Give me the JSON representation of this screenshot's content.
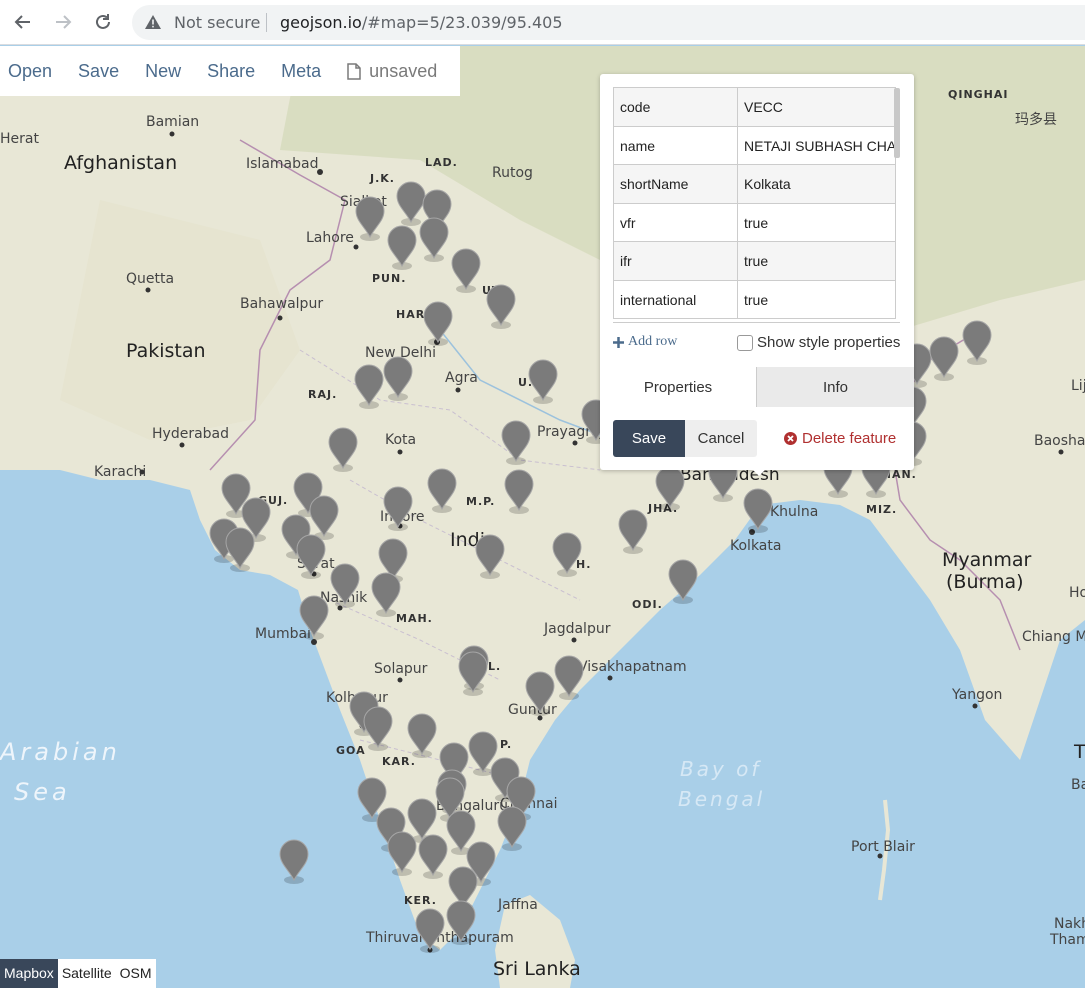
{
  "browser": {
    "security_label": "Not secure",
    "url_host": "geojson.io",
    "url_path": "/#map=5/23.039/95.405"
  },
  "toolbar": {
    "open": "Open",
    "save": "Save",
    "new": "New",
    "share": "Share",
    "meta": "Meta",
    "file_status": "unsaved"
  },
  "popup": {
    "properties": [
      {
        "key": "code",
        "value": "VECC"
      },
      {
        "key": "name",
        "value": "NETAJI SUBHASH CHANDRA BOSE INTL"
      },
      {
        "key": "shortName",
        "value": "Kolkata"
      },
      {
        "key": "vfr",
        "value": "true"
      },
      {
        "key": "ifr",
        "value": "true"
      },
      {
        "key": "international",
        "value": "true"
      }
    ],
    "add_row": "Add row",
    "show_style": "Show style properties",
    "tab_properties": "Properties",
    "tab_info": "Info",
    "save": "Save",
    "cancel": "Cancel",
    "delete": "Delete feature"
  },
  "map_labels": {
    "countries": [
      "Afghanistan",
      "Pakistan",
      "India",
      "Myanmar",
      "(Burma)",
      "Sri Lanka"
    ],
    "states": [
      "J.K.",
      "LAD.",
      "PUN.",
      "HAR.",
      "RAJ.",
      "U.",
      "GUJ.",
      "M.P.",
      "MAH.",
      "KAR.",
      "KER.",
      "ODI.",
      "JHA.",
      "MIZ.",
      "MAN.",
      "GOA",
      "P.",
      "L.",
      "H.",
      "UT"
    ],
    "cities": [
      "Bamian",
      "Herat",
      "Islamabad",
      "Rutog",
      "Sialkot",
      "Lahore",
      "Quetta",
      "Bahawalpur",
      "New Delhi",
      "Agra",
      "Hyderabad",
      "Karachi",
      "Kota",
      "Prayagraj",
      "Indore",
      "Surat",
      "Nashik",
      "Mumbai",
      "Solapur",
      "Kolhapur",
      "Jagdalpur",
      "Visakhapatnam",
      "Guntur",
      "Bengaluru",
      "Chennai",
      "Jaffna",
      "Thiruvananthapuram",
      "Kolkata",
      "Khulna",
      "Bangladesh",
      "Yangon",
      "Chiang Mai",
      "Port Blair",
      "Baoshan",
      "QINGHAI",
      "玛多县",
      "Lij",
      "Ho",
      "T",
      "Ba",
      "Nakh",
      "Tham"
    ],
    "seas": [
      "Arabian",
      "Sea",
      "Bay of",
      "Bengal"
    ]
  },
  "layers": {
    "mapbox": "Mapbox",
    "satellite": "Satellite",
    "osm": "OSM"
  },
  "colors": {
    "water": "#a9cfe8",
    "land": "#e8e7d6",
    "marker": "#7b7b7b",
    "accent": "#39475a",
    "link": "#4b6b8c"
  }
}
